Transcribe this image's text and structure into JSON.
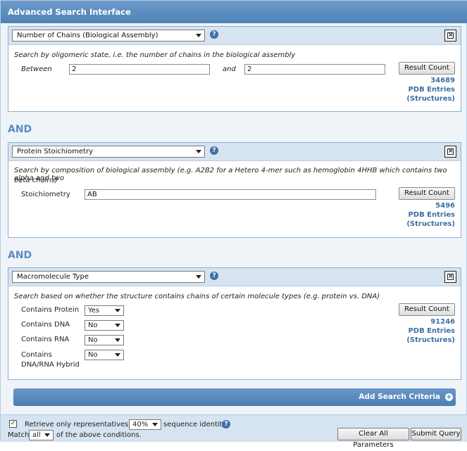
{
  "title": "Advanced Search Interface",
  "and_label": "AND",
  "result_button_label": "Result Count",
  "count_unit_line1": "PDB Entries",
  "count_unit_line2": "(Structures)",
  "criteria": [
    {
      "type": "Number of Chains (Biological Assembly)",
      "description": "Search by oligomeric state, i.e. the number of chains in the biological assembly",
      "between_label": "Between",
      "and_label": "and",
      "min_value": "2",
      "max_value": "2",
      "count": "34689"
    },
    {
      "type": "Protein Stoichiometry",
      "description_line1": "Search by composition of biological assembly (e.g. A2B2 for a Hetero 4-mer such as hemoglobin 4HHB which contains two alpha and two",
      "description_line2": "beta chains)",
      "field_label": "Stoichiometry",
      "value": "AB",
      "count": "5496"
    },
    {
      "type": "Macromolecule Type",
      "description": "Search based on whether the structure contains chains of certain molecule types (e.g. protein vs. DNA)",
      "count": "91246",
      "rows": [
        {
          "label": "Contains Protein",
          "value": "Yes"
        },
        {
          "label": "Contains DNA",
          "value": "No"
        },
        {
          "label": "Contains RNA",
          "value": "No"
        },
        {
          "label_line1": "Contains",
          "label_line2": "DNA/RNA Hybrid",
          "value": "No"
        }
      ]
    }
  ],
  "add_criteria_label": "Add Search Criteria",
  "footer": {
    "representatives_checked": true,
    "representatives_text_before": "Retrieve only representatives at",
    "identity_value": "40%",
    "representatives_text_after": "sequence identity",
    "match_label": "Match",
    "match_value": "all",
    "match_suffix": "of the above conditions.",
    "clear_label": "Clear All Parameters",
    "submit_label": "Submit Query"
  },
  "icons": {
    "help": "question-icon",
    "remove": "close-box-icon",
    "add": "plus-circle-icon",
    "dropdown": "chevron-down-icon"
  },
  "colors": {
    "title_bar": "#5a8bbd",
    "link_blue": "#3c6fa3",
    "and_blue": "#5b8cc0",
    "panel_head": "#d6e3f0"
  }
}
